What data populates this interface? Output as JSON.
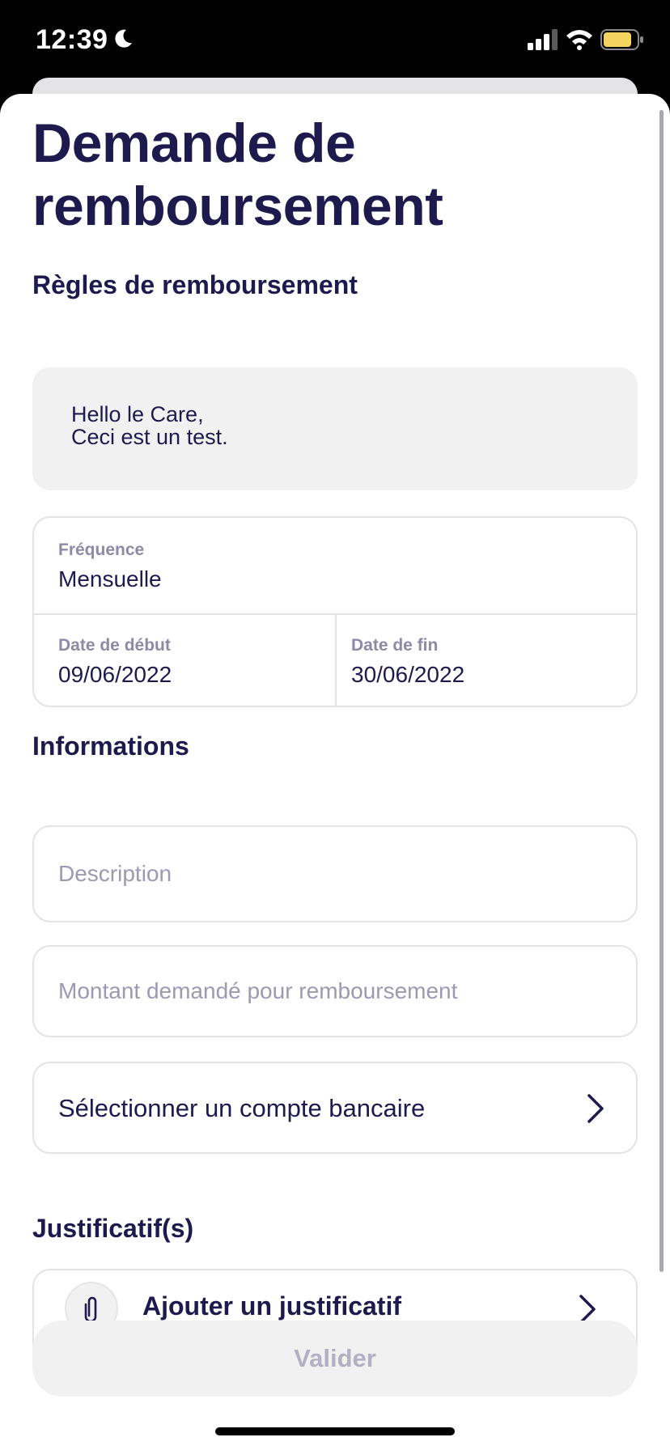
{
  "status_bar": {
    "time": "12:39",
    "icons": [
      "moon-icon",
      "signal-icon",
      "wifi-icon",
      "battery-icon"
    ],
    "battery_color": "#f4d35e"
  },
  "page": {
    "title": "Demande de remboursement"
  },
  "rules": {
    "section_title": "Règles de remboursement",
    "message": "Hello le Care,\nCeci est un test.",
    "frequency_label": "Fréquence",
    "frequency_value": "Mensuelle",
    "start_label": "Date de début",
    "start_value": "09/06/2022",
    "end_label": "Date de fin",
    "end_value": "30/06/2022"
  },
  "informations": {
    "section_title": "Informations",
    "description_placeholder": "Description",
    "amount_placeholder": "Montant demandé pour remboursement",
    "bank_select_label": "Sélectionner un compte bancaire"
  },
  "justificatifs": {
    "section_title": "Justificatif(s)",
    "add_label": "Ajouter un justificatif"
  },
  "actions": {
    "validate_label": "Valider"
  },
  "colors": {
    "primary_text": "#1f1a4d",
    "muted_label": "#8d8aa6",
    "placeholder": "#9c99b0",
    "border": "#e3e3e6",
    "surface": "#f1f1f2"
  }
}
